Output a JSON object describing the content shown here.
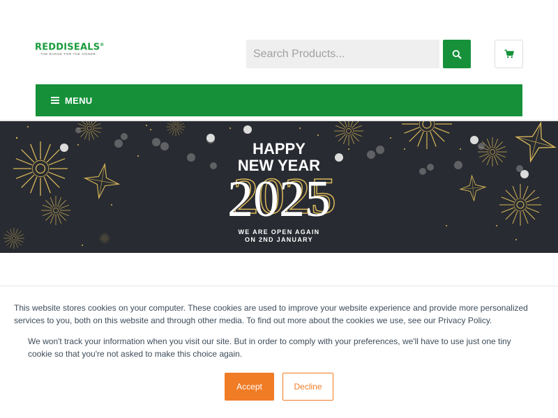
{
  "header": {
    "logo_text": "REDDISEALS",
    "logo_reg": "®",
    "logo_tagline": "THE RANGE FOR THE JOINER",
    "search_placeholder": "Search Products...",
    "search_icon": "search-icon",
    "cart_icon": "cart-icon",
    "menu_label": "MENU",
    "menu_icon": "hamburger-icon"
  },
  "banner": {
    "line1": "HAPPY",
    "line2": "NEW YEAR",
    "year": "2025",
    "sub1": "WE ARE OPEN AGAIN",
    "sub2": "ON 2ND JANUARY"
  },
  "cookie": {
    "text1": "This website stores cookies on your computer. These cookies are used to improve your website experience and provide more personalized services to you, both on this website and through other media. To find out more about the cookies we use, see our Privacy Policy.",
    "text2": "We won't track your information when you visit our site. But in order to comply with your preferences, we'll have to use just one tiny cookie so that you're not asked to make this choice again.",
    "accept_label": "Accept",
    "decline_label": "Decline"
  },
  "colors": {
    "brand_green": "#16913a",
    "banner_bg": "#282b31",
    "gold": "#d9b75a",
    "accent_orange": "#f07c26"
  }
}
